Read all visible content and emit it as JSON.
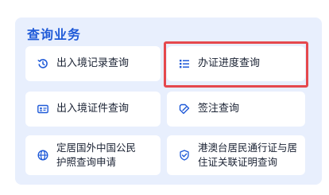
{
  "section": {
    "title": "查询业务"
  },
  "items": [
    {
      "label": "出入境记录查询",
      "icon": "history-clock-icon"
    },
    {
      "label": "办证进度查询",
      "icon": "list-icon"
    },
    {
      "label": "出入境证件查询",
      "icon": "id-card-icon"
    },
    {
      "label": "签注查询",
      "icon": "tag-icon"
    },
    {
      "label": "定居国外中国公民护照查询申请",
      "label_line1": "定居国外中国公民",
      "label_line2": "护照查询申请",
      "icon": "globe-icon"
    },
    {
      "label": "港澳台居民通行证与居住证关联证明查询",
      "label_line1": "港澳台居民通行证与居",
      "label_line2": "住证关联证明查询",
      "icon": "shield-check-icon"
    }
  ],
  "highlight": {
    "target": "办证进度查询",
    "color": "#e5484d"
  },
  "colors": {
    "accent": "#1f5ad8",
    "panel_bg": "#e8effd",
    "card_bg": "#ffffff"
  }
}
